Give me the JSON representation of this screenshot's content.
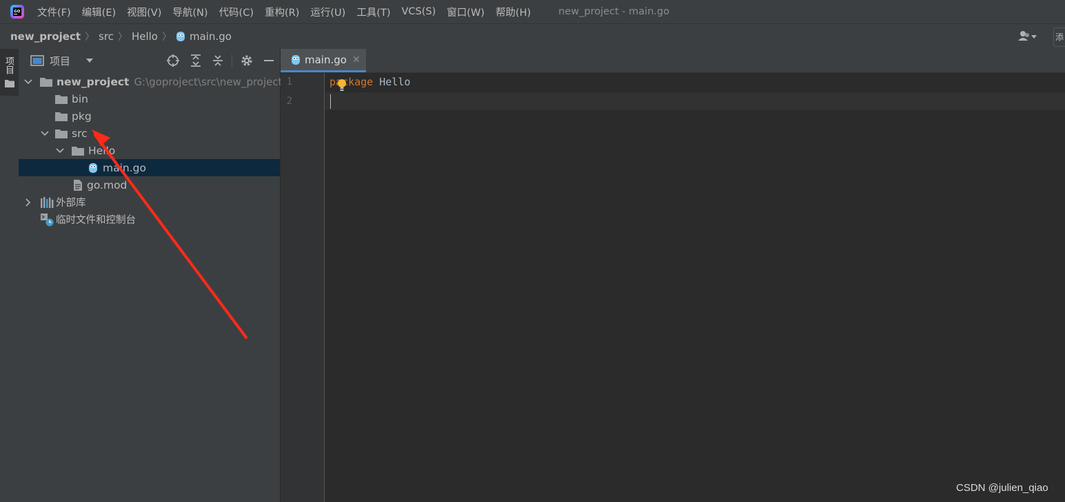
{
  "menubar": {
    "items": [
      "文件(F)",
      "编辑(E)",
      "视图(V)",
      "导航(N)",
      "代码(C)",
      "重构(R)",
      "运行(U)",
      "工具(T)",
      "VCS(S)",
      "窗口(W)",
      "帮助(H)"
    ],
    "window_title": "new_project - main.go"
  },
  "breadcrumb": {
    "root": "new_project",
    "items": [
      "src",
      "Hello",
      "main.go"
    ],
    "right_button": "添"
  },
  "tool_stripe": {
    "project_label": "项目"
  },
  "project_panel": {
    "title": "项目",
    "root": {
      "name": "new_project",
      "path": "G:\\goproject\\src\\new_project"
    },
    "items": {
      "bin": "bin",
      "pkg": "pkg",
      "src": "src",
      "hello": "Hello",
      "main_go": "main.go",
      "go_mod": "go.mod",
      "external_libs": "外部库",
      "scratches": "临时文件和控制台"
    }
  },
  "editor": {
    "tab": {
      "label": "main.go"
    },
    "line_numbers": [
      "1",
      "2"
    ],
    "code": {
      "keyword": "package",
      "name": "Hello"
    }
  },
  "watermark": "CSDN @julien_qiao",
  "colors": {
    "accent": "#4a88c7",
    "keyword": "#cc7832",
    "annotation_arrow": "#ff2a1a"
  }
}
